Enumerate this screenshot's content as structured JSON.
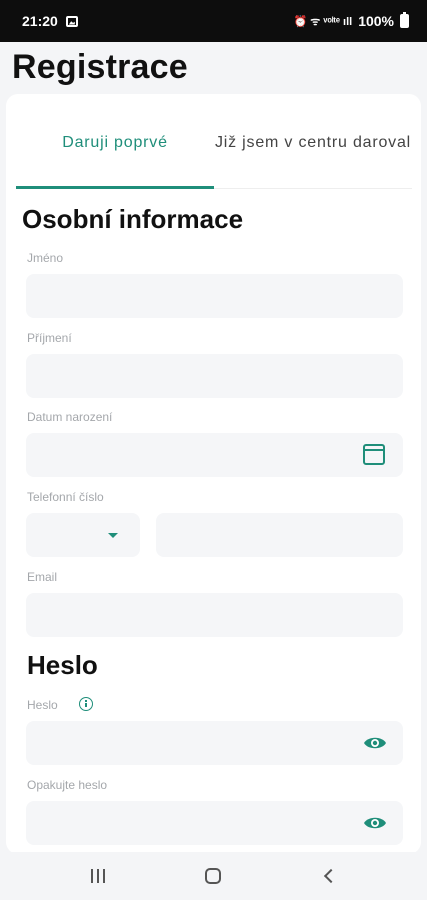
{
  "status_bar": {
    "time": "21:20",
    "icons_right": "⏰ ᯤ ᵛᵒˡᵗᵉ ıll",
    "battery": "100%"
  },
  "page": {
    "title": "Registrace"
  },
  "tabs": [
    {
      "label": "Daruji poprvé",
      "active": true
    },
    {
      "label": "Již jsem v centru daroval",
      "active": false
    }
  ],
  "personal_section": {
    "title": "Osobní informace",
    "first_name": {
      "label": "Jméno",
      "value": ""
    },
    "last_name": {
      "label": "Příjmení",
      "value": ""
    },
    "birth_date": {
      "label": "Datum narození",
      "value": ""
    },
    "phone": {
      "label": "Telefonní číslo",
      "prefix": "",
      "value": ""
    },
    "email": {
      "label": "Email",
      "value": ""
    }
  },
  "password_section": {
    "title": "Heslo",
    "password": {
      "label": "Heslo",
      "value": ""
    },
    "password_repeat": {
      "label": "Opakujte heslo",
      "value": ""
    }
  },
  "colors": {
    "accent": "#1f8e7a",
    "field_bg": "#f5f6f8",
    "label": "#a4a7ab"
  },
  "icons": [
    "calendar-icon",
    "chevron-down-icon",
    "info-icon",
    "eye-icon",
    "recent-apps-icon",
    "home-icon",
    "back-icon"
  ]
}
